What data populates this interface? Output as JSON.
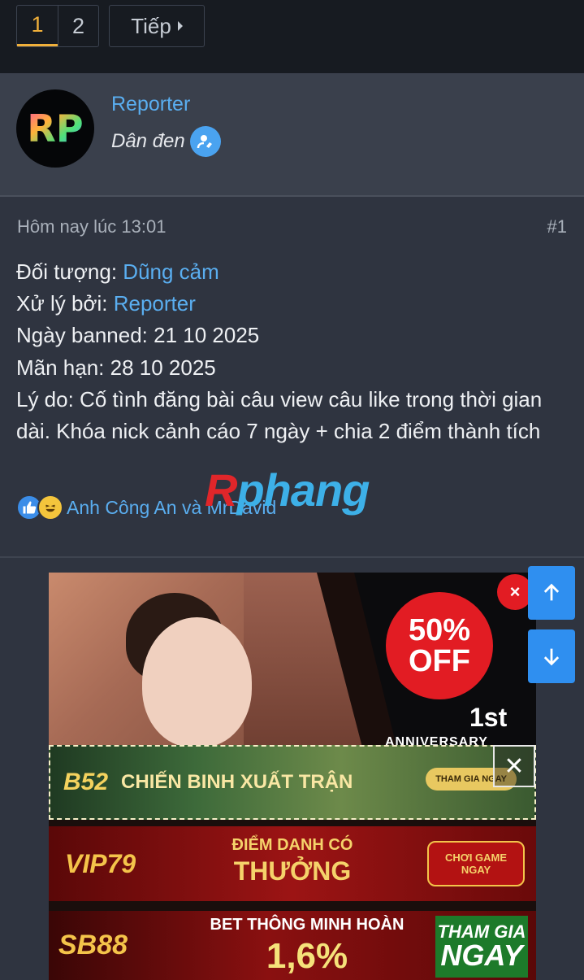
{
  "pagination": {
    "pages": [
      "1",
      "2"
    ],
    "current": "1",
    "next_label": "Tiếp"
  },
  "user": {
    "avatar_initials": "RP",
    "name": "Reporter",
    "title": "Dân đen"
  },
  "post": {
    "time": "Hôm nay lúc 13:01",
    "number": "#1",
    "lines": {
      "subject_label": "Đối tượng: ",
      "subject_value": "Dũng cảm",
      "handler_label": "Xử lý bởi: ",
      "handler_value": "Reporter",
      "banned": "Ngày banned: 21 10 2025",
      "expiry": "Mãn hạn: 28 10 2025",
      "reason": "Lý do: Cố tình đăng bài câu view câu like trong thời gian dài. Khóa nick cảnh cáo 7 ngày + chia 2 điểm thành tích"
    },
    "reactions_text": "Anh Công An và MrDavid"
  },
  "watermark": {
    "part1": "R",
    "part2": "phang"
  },
  "ads": {
    "main": {
      "discount_1": "50%",
      "discount_2": "OFF",
      "anniv_1": "1st",
      "anniv_2": "ANNIVERSARY",
      "close": "×"
    },
    "b52": {
      "logo": "B52",
      "text": "CHIẾN BINH XUẤT TRẬN",
      "cta": "THAM GIA NGAY",
      "close": "✕"
    },
    "vip79": {
      "logo": "VIP79",
      "line1": "ĐIỂM DANH CÓ",
      "line2": "THƯỞNG",
      "cta1": "CHƠI GAME",
      "cta2": "NGAY"
    },
    "sb88": {
      "logo": "SB88",
      "line1": "BET THÔNG MINH HOÀN",
      "line2": "1,6%",
      "cta1": "THAM GIA",
      "cta2": "NGAY"
    }
  },
  "colors": {
    "link": "#5aaef0",
    "accent": "#f0b03a",
    "scroll_button": "#2f8ff0"
  }
}
